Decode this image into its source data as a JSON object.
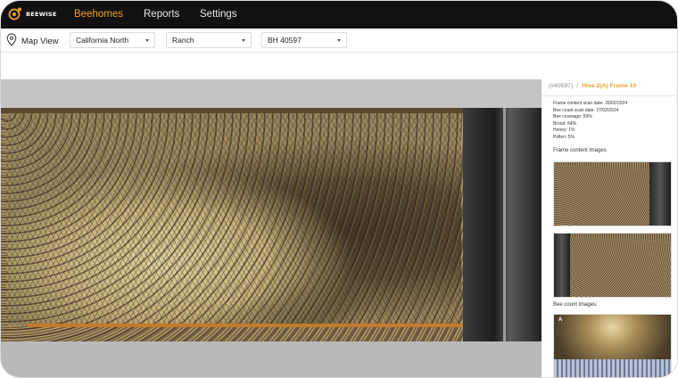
{
  "app": {
    "brand": "BEEWISE",
    "nav": [
      {
        "label": "Beehomes",
        "active": true
      },
      {
        "label": "Reports",
        "active": false
      },
      {
        "label": "Settings",
        "active": false
      }
    ],
    "accent_color": "#f0a028"
  },
  "filters": {
    "map_view_label": "Map View",
    "region": "California North",
    "site": "Ranch",
    "beehome": "BH 40597"
  },
  "panel": {
    "breadcrumb_root": "(#40597)",
    "breadcrumb_sep": "/",
    "breadcrumb_current": "Hive 2(A) Frame 10",
    "meta": {
      "scan_date": "Frame content scan date: 26/02/2024",
      "bee_count_date": "Bee count scan date: 27/02/2024",
      "coverage": "Bee coverage: 59%",
      "brood": "Brood: 64%",
      "honey": "Honey: 1%",
      "pollen": "Pollen: 5%"
    },
    "frame_images_title": "Frame content images",
    "bee_count_title": "Bee count images:",
    "bee_count_badge": "A"
  }
}
